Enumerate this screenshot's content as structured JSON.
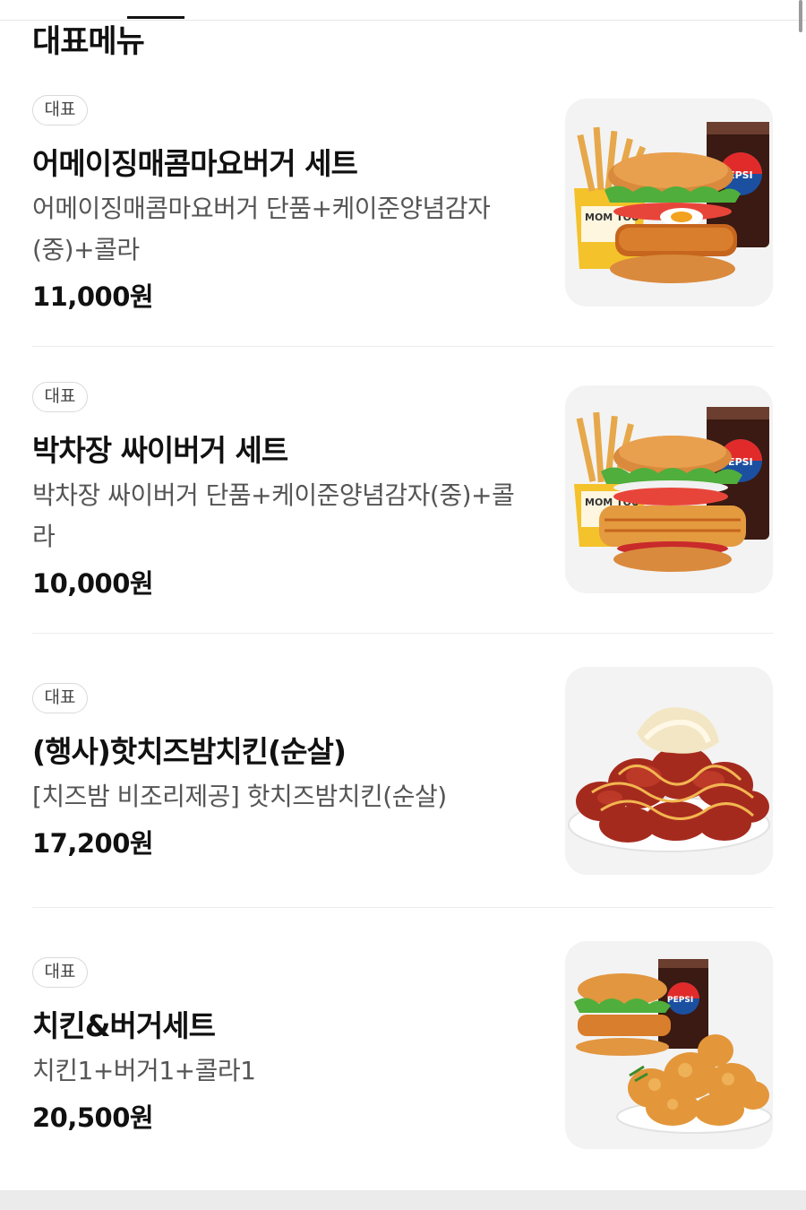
{
  "section": {
    "title": "대표메뉴"
  },
  "items": [
    {
      "badge": "대표",
      "name": "어메이징매콤마요버거 세트",
      "description": "어메이징매콤마요버거 단품+케이준양념감자(중)+콜라",
      "price": "11,000원",
      "image_icon": "burger-set-photo",
      "drink_label": "PEPSI",
      "fries_box_label": "MOM TOU"
    },
    {
      "badge": "대표",
      "name": "박차장 싸이버거 세트",
      "description": "박차장 싸이버거 단품+케이준양념감자(중)+콜라",
      "price": "10,000원",
      "image_icon": "burger-set-photo",
      "drink_label": "PEPSI",
      "fries_box_label": "MOM TOU"
    },
    {
      "badge": "대표",
      "name": "(행사)핫치즈밤치킨(순살)",
      "description": "[치즈밤 비조리제공] 핫치즈밤치킨(순살)",
      "price": "17,200원",
      "image_icon": "cheese-chicken-photo"
    },
    {
      "badge": "대표",
      "name": "치킨&버거세트",
      "description": "치킨1+버거1+콜라1",
      "price": "20,500원",
      "image_icon": "chicken-burger-set-photo",
      "drink_label": "PEPSI"
    }
  ],
  "colors": {
    "badge_border": "#d9d9d9",
    "divider": "#ececec",
    "thumb_bg": "#f3f3f3",
    "desc_text": "#555555"
  }
}
